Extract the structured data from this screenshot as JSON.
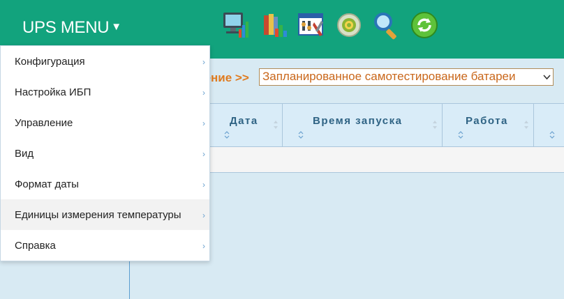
{
  "brand": {
    "title": "UPS MENU",
    "caret": "▼"
  },
  "toolbar": {
    "icons": [
      "monitor-chart-icon",
      "books-chart-icon",
      "settings-window-icon",
      "gear-icon",
      "search-icon",
      "refresh-icon"
    ]
  },
  "breadcrumb": {
    "text": "ление >>"
  },
  "event_select": {
    "value": "Запланированное самотестирование батареи"
  },
  "table": {
    "columns": [
      "Дата",
      "Время запуска",
      "Работа"
    ]
  },
  "menu": {
    "items": [
      {
        "label": "Конфигурация"
      },
      {
        "label": "Настройка ИБП"
      },
      {
        "label": "Управление"
      },
      {
        "label": "Вид"
      },
      {
        "label": "Формат даты"
      },
      {
        "label": "Единицы измерения температуры"
      },
      {
        "label": "Справка"
      }
    ]
  },
  "colors": {
    "header": "#12a37d",
    "panel": "#d8eaf3",
    "accent": "#e07b1f",
    "column_text": "#2f6384"
  }
}
